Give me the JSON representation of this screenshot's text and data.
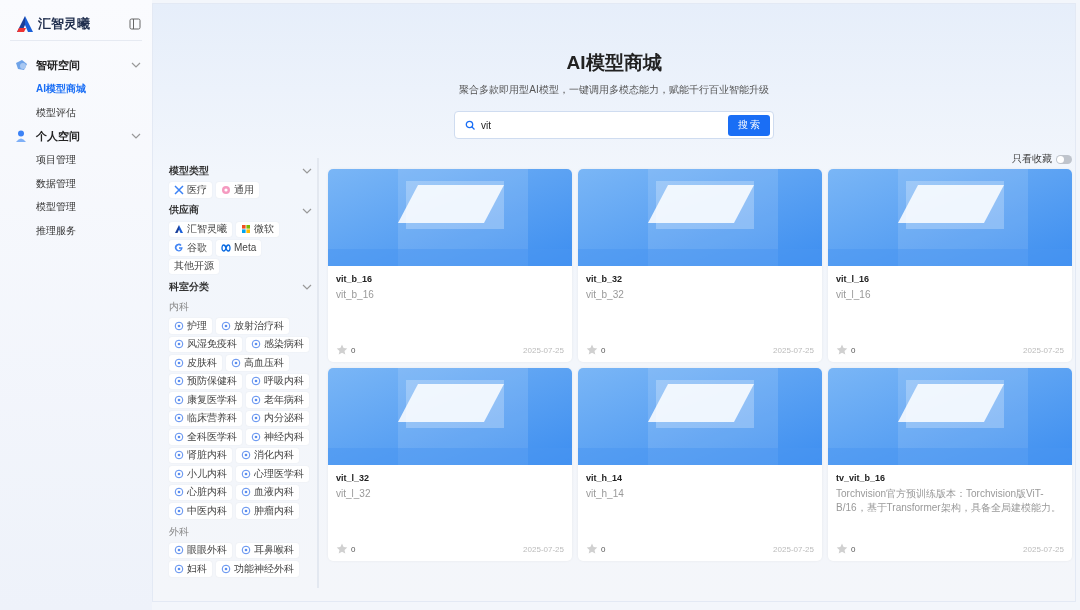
{
  "sidebar": {
    "logo_text": "汇智灵曦",
    "groups": [
      {
        "label": "智研空间",
        "expanded": true,
        "items": [
          {
            "label": "AI模型商城",
            "selected": true
          },
          {
            "label": "模型评估",
            "selected": false
          }
        ]
      },
      {
        "label": "个人空间",
        "expanded": true,
        "items": [
          {
            "label": "项目管理",
            "selected": false
          },
          {
            "label": "数据管理",
            "selected": false
          },
          {
            "label": "模型管理",
            "selected": false
          },
          {
            "label": "推理服务",
            "selected": false
          }
        ]
      }
    ]
  },
  "header": {
    "title": "AI模型商城",
    "subtitle": "聚合多款即用型AI模型，一键调用多模态能力，赋能千行百业智能升级",
    "search": {
      "value": "vit",
      "button": "搜 索"
    }
  },
  "favorites_only": {
    "label": "只看收藏",
    "on": false
  },
  "filters": [
    {
      "title": "模型类型",
      "expanded": true,
      "groups": [
        {
          "tags": [
            "医疗",
            "通用"
          ]
        }
      ]
    },
    {
      "title": "供应商",
      "expanded": true,
      "groups": [
        {
          "tags": [
            "汇智灵曦",
            "微软",
            "谷歌",
            "Meta",
            "其他开源"
          ]
        }
      ]
    },
    {
      "title": "科室分类",
      "expanded": true,
      "groups": [
        {
          "label": "内科",
          "tags": [
            "护理",
            "放射治疗科",
            "风湿免疫科",
            "感染病科",
            "皮肤科",
            "高血压科",
            "预防保健科",
            "呼吸内科",
            "康复医学科",
            "老年病科",
            "临床营养科",
            "内分泌科",
            "全科医学科",
            "神经内科",
            "肾脏内科",
            "消化内科",
            "小儿内科",
            "心理医学科",
            "心脏内科",
            "血液内科",
            "中医内科",
            "肿瘤内科"
          ]
        },
        {
          "label": "外科",
          "tags": [
            "眼眼外科",
            "耳鼻喉科",
            "妇科",
            "功能神经外科"
          ]
        }
      ]
    }
  ],
  "cards": [
    {
      "name": "vit_b_16",
      "description": "vit_b_16",
      "favorites": "0",
      "favorited": false,
      "date": "2025-07-25"
    },
    {
      "name": "vit_b_32",
      "description": "vit_b_32",
      "favorites": "0",
      "favorited": false,
      "date": "2025-07-25"
    },
    {
      "name": "vit_l_16",
      "description": "vit_l_16",
      "favorites": "0",
      "favorited": false,
      "date": "2025-07-25"
    },
    {
      "name": "vit_l_32",
      "description": "vit_l_32",
      "favorites": "0",
      "favorited": false,
      "date": "2025-07-25"
    },
    {
      "name": "vit_h_14",
      "description": "vit_h_14",
      "favorites": "0",
      "favorited": false,
      "date": "2025-07-25"
    },
    {
      "name": "tv_vit_b_16",
      "description": "Torchvision官方预训练版本：Torchvision版ViT-B/16，基于Transformer架构，具备全局建模能力。",
      "favorites": "0",
      "favorited": false,
      "date": "2025-07-25"
    }
  ]
}
